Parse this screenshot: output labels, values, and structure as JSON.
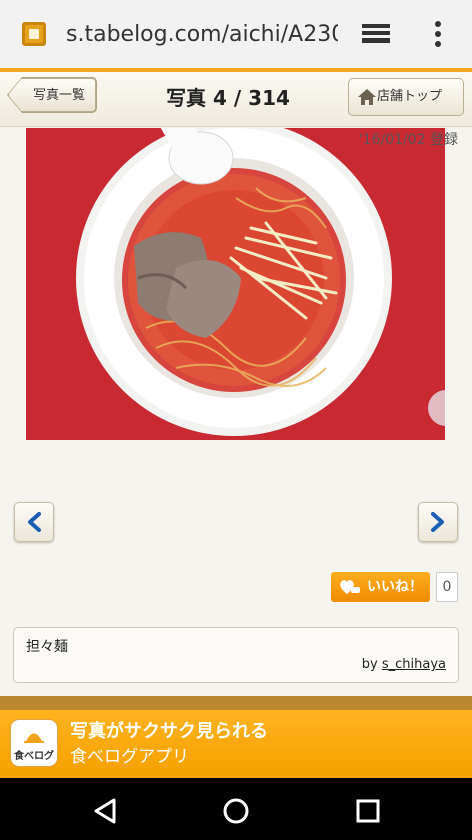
{
  "browser": {
    "url": "s.tabelog.com/aichi/A230",
    "favicon": "tabelog-favicon-icon",
    "tabs_icon": "tabs-switcher-icon",
    "menu_icon": "overflow-menu-icon"
  },
  "header": {
    "back_label": "写真一覧",
    "title": "写真 4 / 314",
    "home_label": "店舗トップ",
    "home_icon": "home-icon"
  },
  "photo": {
    "date": "'16/01/02 登録",
    "subject": "ramen-bowl-image"
  },
  "nav": {
    "prev_icon": "chevron-left-icon",
    "next_icon": "chevron-right-icon"
  },
  "like": {
    "label": "いいね！",
    "count": "0",
    "icon": "heart-hand-icon"
  },
  "caption": {
    "text": "担々麺",
    "by_prefix": "by",
    "user": "s_chihaya"
  },
  "banner": {
    "app_icon_label": "食べログ",
    "title": "写真がサクサク見られる",
    "subtitle": "食べログアプリ"
  },
  "colors": {
    "accent": "#f5a623",
    "banner": "#f5a000",
    "link_blue": "#1a5fb4"
  }
}
